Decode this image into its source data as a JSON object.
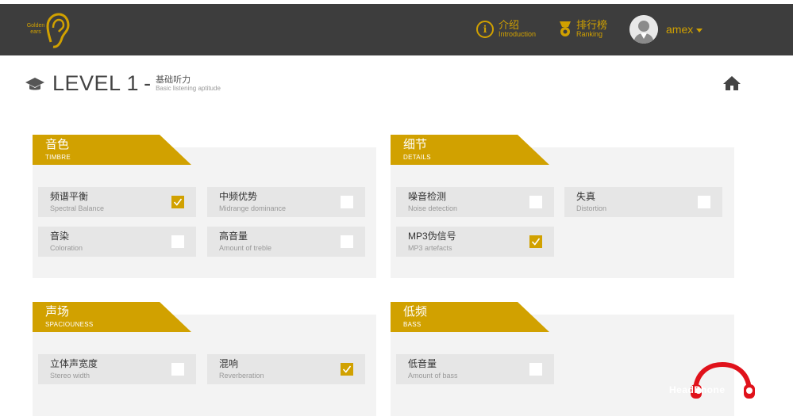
{
  "top_strip_text": "",
  "logo": {
    "text_line1": "Golden",
    "text_line2": "ears"
  },
  "nav": {
    "intro": {
      "cn": "介绍",
      "en": "Introduction"
    },
    "ranking": {
      "cn": "排行榜",
      "en": "Ranking"
    },
    "user": "amex"
  },
  "page": {
    "level": "LEVEL 1",
    "dash": "-",
    "sub_cn": "基础听力",
    "sub_en": "Basic listening aptitude"
  },
  "colors": {
    "accent": "#d1a100",
    "navbar": "#3d3d3d",
    "panel": "#f3f3f3",
    "item": "#e6e6e6"
  },
  "sections": [
    {
      "cn": "音色",
      "en": "TIMBRE",
      "items": [
        {
          "cn": "频谱平衡",
          "en": "Spectral Balance",
          "checked": true
        },
        {
          "cn": "中频优势",
          "en": "Midrange dominance",
          "checked": false
        },
        {
          "cn": "音染",
          "en": "Coloration",
          "checked": false
        },
        {
          "cn": "高音量",
          "en": "Amount of treble",
          "checked": false
        }
      ]
    },
    {
      "cn": "细节",
      "en": "DETAILS",
      "items": [
        {
          "cn": "噪音检测",
          "en": "Noise detection",
          "checked": false
        },
        {
          "cn": "失真",
          "en": "Distortion",
          "checked": false
        },
        {
          "cn": "MP3伪信号",
          "en": "MP3 artefacts",
          "checked": true
        }
      ]
    },
    {
      "cn": "声场",
      "en": "SPACIOUNESS",
      "items": [
        {
          "cn": "立体声宽度",
          "en": "Stereo width",
          "checked": false
        },
        {
          "cn": "混响",
          "en": "Reverberation",
          "checked": true
        }
      ]
    },
    {
      "cn": "低频",
      "en": "BASS",
      "items": [
        {
          "cn": "低音量",
          "en": "Amount of bass",
          "checked": false
        }
      ]
    }
  ],
  "watermark": {
    "text": "HeadPhone"
  }
}
